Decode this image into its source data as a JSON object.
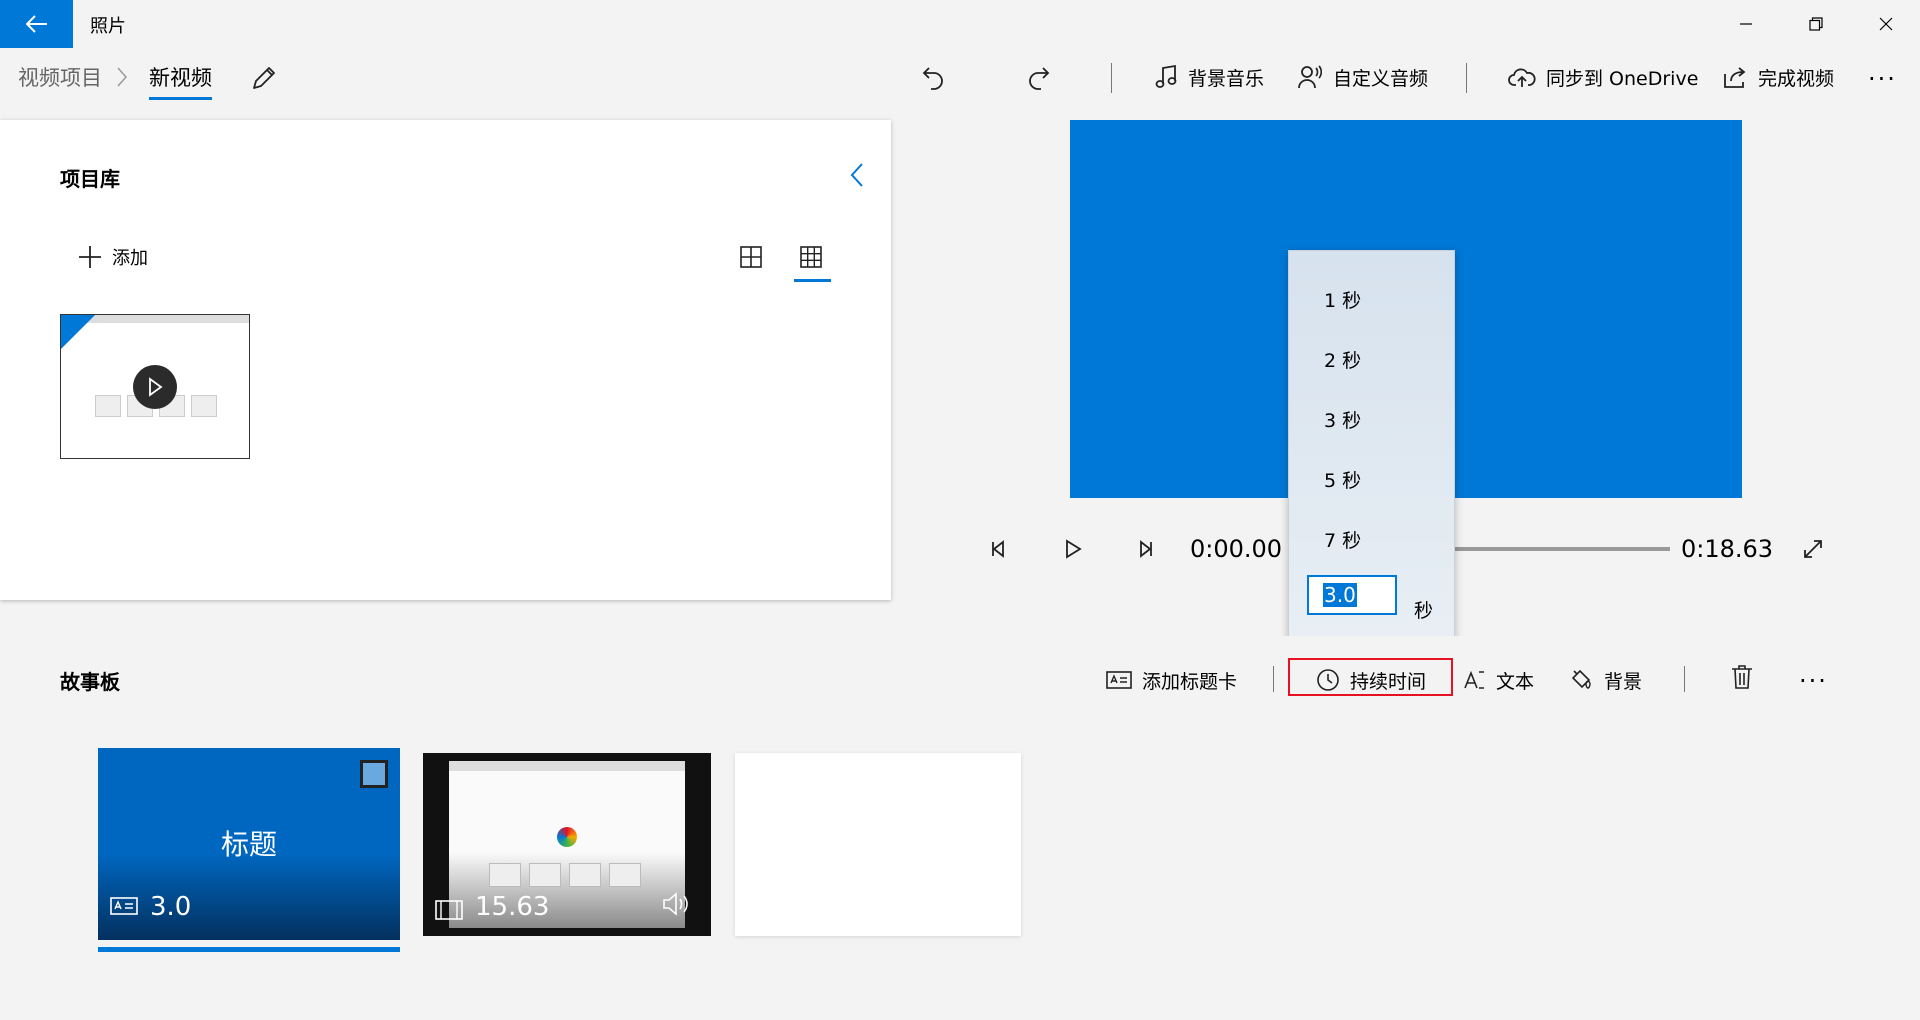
{
  "app": {
    "title": "照片"
  },
  "breadcrumb": {
    "parent": "视频项目",
    "current": "新视频"
  },
  "toolbar": {
    "background_music": "背景音乐",
    "custom_audio": "自定义音频",
    "sync_onedrive": "同步到 OneDrive",
    "finish_video": "完成视频",
    "more": "..."
  },
  "library": {
    "title": "项目库",
    "add_label": "添加"
  },
  "player": {
    "current_time": "0:00.00",
    "total_time": "0:18.63"
  },
  "duration_menu": {
    "options": [
      "1 秒",
      "2 秒",
      "3 秒",
      "5 秒",
      "7 秒"
    ],
    "custom_value": "3.0",
    "unit": "秒"
  },
  "storyboard": {
    "title": "故事板",
    "add_title_card": "添加标题卡",
    "duration": "持续时间",
    "text": "文本",
    "background": "背景",
    "more": "...",
    "cards": [
      {
        "label": "标题",
        "duration": "3.0"
      },
      {
        "duration": "15.63"
      }
    ]
  },
  "colors": {
    "accent": "#0078d7",
    "highlight_box": "#e81123"
  }
}
